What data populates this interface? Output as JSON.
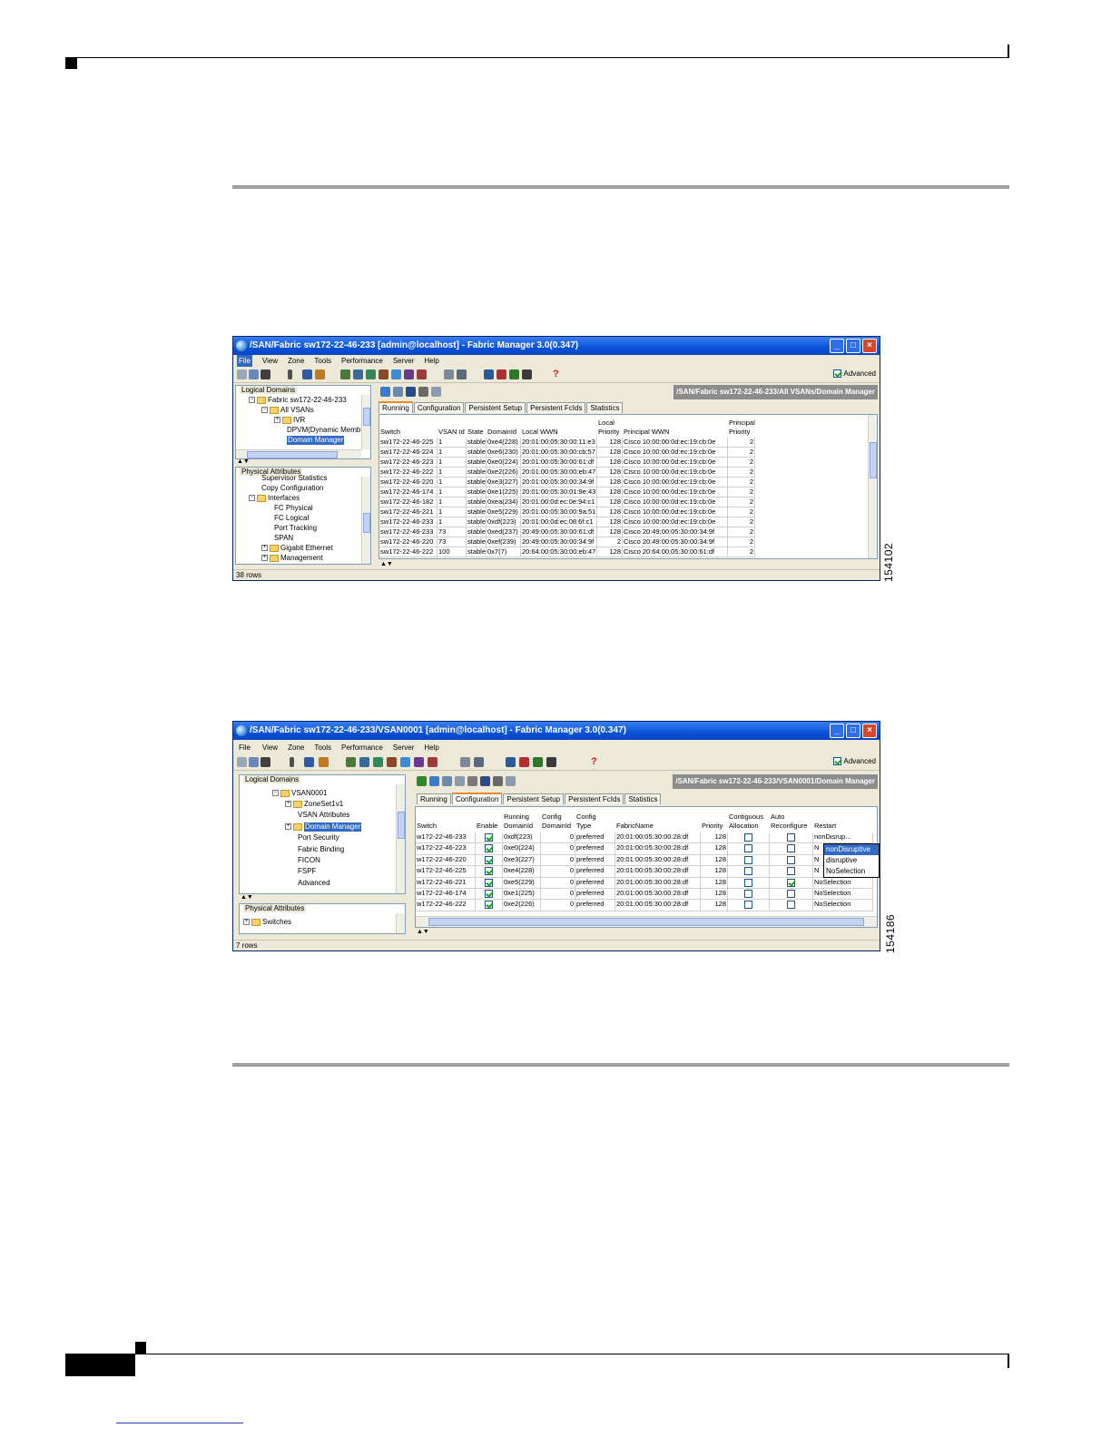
{
  "figure1": {
    "title": "/SAN/Fabric sw172-22-46-233 [admin@localhost] - Fabric Manager 3.0(0.347)",
    "menu": [
      "File",
      "View",
      "Zone",
      "Tools",
      "Performance",
      "Server",
      "Help"
    ],
    "advanced_label": "Advanced",
    "logical_domains_label": "Logical Domains",
    "physical_attributes_label": "Physical Attributes",
    "logical_tree": [
      {
        "label": "Fabric sw172-22-46-233",
        "expander": "⊟",
        "folder": true
      },
      {
        "label": "All VSANs",
        "expander": "⊟",
        "folder": true
      },
      {
        "label": "IVR",
        "expander": "⊞",
        "folder": true
      },
      {
        "label": "DPVM(Dynamic Memb",
        "expander": "",
        "folder": false
      },
      {
        "label": "Domain Manager",
        "expander": "",
        "folder": false
      }
    ],
    "physical_tree": [
      {
        "label": "Supervisor Statistics",
        "expander": "",
        "folder": false
      },
      {
        "label": "Copy Configuration",
        "expander": "",
        "folder": false
      },
      {
        "label": "Interfaces",
        "expander": "⊟",
        "folder": true
      },
      {
        "label": "FC Physical",
        "expander": "",
        "folder": false
      },
      {
        "label": "FC Logical",
        "expander": "",
        "folder": false
      },
      {
        "label": "Port Tracking",
        "expander": "",
        "folder": false
      },
      {
        "label": "SPAN",
        "expander": "",
        "folder": false
      },
      {
        "label": "Gigabit Ethernet",
        "expander": "⊞",
        "folder": true
      },
      {
        "label": "Management",
        "expander": "⊞",
        "folder": true
      }
    ],
    "path_label": "/SAN/Fabric sw172-22-46-233/All VSANs/Domain Manager",
    "tabs": [
      "Running",
      "Configuration",
      "Persistent Setup",
      "Persistent FcIds",
      "Statistics"
    ],
    "active_tab": 0,
    "columns": [
      {
        "h1": "",
        "h2": "Switch"
      },
      {
        "h1": "",
        "h2": "VSAN Id"
      },
      {
        "h1": "",
        "h2": "State"
      },
      {
        "h1": "",
        "h2": "DomainId"
      },
      {
        "h1": "",
        "h2": "Local WWN"
      },
      {
        "h1": "Local",
        "h2": "Priority"
      },
      {
        "h1": "",
        "h2": "Principal WWN"
      },
      {
        "h1": "Principal",
        "h2": "Priority"
      }
    ],
    "rows": [
      [
        "sw172-22-46-225",
        "1",
        "stable",
        "0xe4(228)",
        "20:01:00:05:30:00:11:e3",
        "128",
        "Cisco 10:00:00:0d:ec:19:cb:0e",
        "2"
      ],
      [
        "sw172-22-46-224",
        "1",
        "stable",
        "0xe6(230)",
        "20:01:00:05:30:00:cb:57",
        "128",
        "Cisco 10:00:00:0d:ec:19:cb:0e",
        "2"
      ],
      [
        "sw172-22-46-223",
        "1",
        "stable",
        "0xe0(224)",
        "20:01:00:05:30:00:61:df",
        "128",
        "Cisco 10:00:00:0d:ec:19:cb:0e",
        "2"
      ],
      [
        "sw172-22-46-222",
        "1",
        "stable",
        "0xe2(226)",
        "20:01:00:05:30:00:eb:47",
        "128",
        "Cisco 10:00:00:0d:ec:19:cb:0e",
        "2"
      ],
      [
        "sw172-22-46-220",
        "1",
        "stable",
        "0xe3(227)",
        "20:01:00:05:30:00:34:9f",
        "128",
        "Cisco 10:00:00:0d:ec:19:cb:0e",
        "2"
      ],
      [
        "sw172-22-46-174",
        "1",
        "stable",
        "0xe1(225)",
        "20:01:00:05:30:01:9e:43",
        "128",
        "Cisco 10:00:00:0d:ec:19:cb:0e",
        "2"
      ],
      [
        "sw172-22-46-182",
        "1",
        "stable",
        "0xea(234)",
        "20:01:00:0d:ec:0e:94:c1",
        "128",
        "Cisco 10:00:00:0d:ec:19:cb:0e",
        "2"
      ],
      [
        "sw172-22-46-221",
        "1",
        "stable",
        "0xe5(229)",
        "20:01:00:05:30:00:9a:51",
        "128",
        "Cisco 10:00:00:0d:ec:19:cb:0e",
        "2"
      ],
      [
        "sw172-22-46-233",
        "1",
        "stable",
        "0xdf(223)",
        "20:01:00:0d:ec:08:6f:c1",
        "128",
        "Cisco 10:00:00:0d:ec:19:cb:0e",
        "2"
      ],
      [
        "sw172-22-46-233",
        "73",
        "stable",
        "0xed(237)",
        "20:49:00:05:30:00:61:df",
        "128",
        "Cisco 20:49:00:05:30:00:34:9f",
        "2"
      ],
      [
        "sw172-22-46-220",
        "73",
        "stable",
        "0xef(239)",
        "20:49:00:05:30:00:34:9f",
        "2",
        "Cisco 20:49:00:05:30:00:34:9f",
        "2"
      ],
      [
        "sw172-22-46-222",
        "100",
        "stable",
        "0x7(7)",
        "20:64:00:05:30:00:eb:47",
        "128",
        "Cisco 20:64:00:05:30:00:61:df",
        "2"
      ]
    ],
    "status": "38 rows",
    "figure_id": "154102"
  },
  "figure2": {
    "title": "/SAN/Fabric sw172-22-46-233/VSAN0001 [admin@localhost] - Fabric Manager 3.0(0.347)",
    "menu": [
      "File",
      "View",
      "Zone",
      "Tools",
      "Performance",
      "Server",
      "Help"
    ],
    "advanced_label": "Advanced",
    "logical_domains_label": "Logical Domains",
    "physical_attributes_label": "Physical Attributes",
    "logical_tree": [
      {
        "label": "VSAN0001",
        "expander": "⊟",
        "folder": true
      },
      {
        "label": "ZoneSet1v1",
        "expander": "⊞",
        "folder": true
      },
      {
        "label": "VSAN Attributes",
        "expander": "",
        "folder": false
      },
      {
        "label": "Domain Manager",
        "expander": "⊞",
        "folder": true
      },
      {
        "label": "Port Security",
        "expander": "",
        "folder": false
      },
      {
        "label": "Fabric Binding",
        "expander": "",
        "folder": false
      },
      {
        "label": "FICON",
        "expander": "",
        "folder": false
      },
      {
        "label": "FSPF",
        "expander": "",
        "folder": false
      },
      {
        "label": "Advanced",
        "expander": "",
        "folder": false
      }
    ],
    "physical_tree": [
      {
        "label": "Switches",
        "expander": "⊞",
        "folder": true
      }
    ],
    "path_label": "/SAN/Fabric sw172-22-46-233/VSAN0001/Domain Manager",
    "tabs": [
      "Running",
      "Configuration",
      "Persistent Setup",
      "Persistent FcIds",
      "Statistics"
    ],
    "active_tab": 1,
    "columns": [
      {
        "h1": "",
        "h2": "Switch"
      },
      {
        "h1": "",
        "h2": "Enable"
      },
      {
        "h1": "Running",
        "h2": "DomainId"
      },
      {
        "h1": "Config",
        "h2": "DomainId"
      },
      {
        "h1": "Config",
        "h2": "Type"
      },
      {
        "h1": "",
        "h2": "FabricName"
      },
      {
        "h1": "",
        "h2": "Priority"
      },
      {
        "h1": "Contiguous",
        "h2": "Allocation"
      },
      {
        "h1": "Auto",
        "h2": "Reconfigure"
      },
      {
        "h1": "",
        "h2": "Restart"
      }
    ],
    "rows": [
      [
        "w172-22-46-233",
        true,
        "0xdf(223)",
        "0",
        "preferred",
        "20:01:00:05:30:00:28:df",
        "128",
        false,
        false,
        "nonDisrup..."
      ],
      [
        "w172-22-46-223",
        true,
        "0xe0(224)",
        "0",
        "preferred",
        "20:01:00:05:30:00:28:df",
        "128",
        false,
        false,
        "N"
      ],
      [
        "w172-22-46-220",
        true,
        "0xe3(227)",
        "0",
        "preferred",
        "20:01:00:05:30:00:28:df",
        "128",
        false,
        false,
        "N"
      ],
      [
        "w172-22-46-225",
        true,
        "0xe4(228)",
        "0",
        "preferred",
        "20:01:00:05:30:00:28:df",
        "128",
        false,
        false,
        "N"
      ],
      [
        "w172-22-46-221",
        true,
        "0xe5(229)",
        "0",
        "preferred",
        "20:01:00:05:30:00:28:df",
        "128",
        false,
        true,
        "NoSelection"
      ],
      [
        "w172-22-46-174",
        true,
        "0xe1(225)",
        "0",
        "preferred",
        "20:01:00:05:30:00:28:df",
        "128",
        false,
        false,
        "NoSelection"
      ],
      [
        "w172-22-46-222",
        true,
        "0xe2(226)",
        "0",
        "preferred",
        "20:01:00:05:30:00:28:df",
        "128",
        false,
        false,
        "NoSelection"
      ]
    ],
    "restart_options": [
      "nonDisruptive",
      "disruptive",
      "NoSelection"
    ],
    "restart_highlight": 0,
    "status": "7 rows",
    "figure_id": "154186"
  }
}
